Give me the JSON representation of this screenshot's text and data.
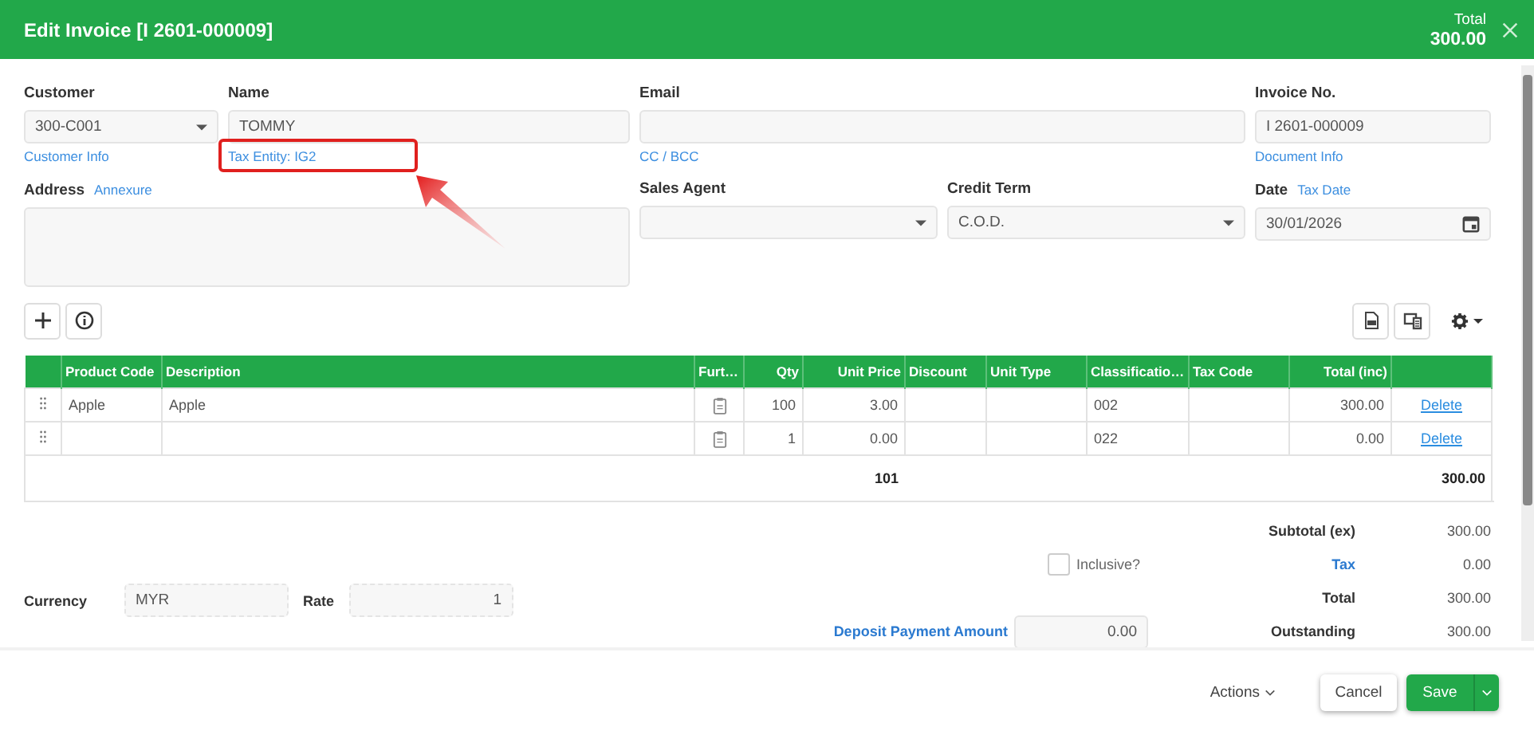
{
  "window": {
    "title": "Edit Invoice [I 2601-000009]",
    "total_label": "Total",
    "total_value": "300.00"
  },
  "customer": {
    "label": "Customer",
    "value": "300-C001",
    "link": "Customer Info"
  },
  "name": {
    "label": "Name",
    "value": "TOMMY",
    "link": "Tax Entity: IG2"
  },
  "email": {
    "label": "Email",
    "link": "CC / BCC"
  },
  "invoice_no": {
    "label": "Invoice No.",
    "value": "I 2601-000009",
    "link": "Document Info"
  },
  "address": {
    "label": "Address",
    "link": "Annexure"
  },
  "sales_agent": {
    "label": "Sales Agent"
  },
  "credit_term": {
    "label": "Credit Term",
    "value": "C.O.D."
  },
  "date": {
    "label": "Date",
    "link": "Tax Date",
    "value": "30/01/2026"
  },
  "table": {
    "columns": [
      "Product Code",
      "Description",
      "Furt…",
      "Qty",
      "Unit Price",
      "Discount",
      "Unit Type",
      "Classificatio…",
      "Tax Code",
      "Total (inc)"
    ],
    "rows": [
      {
        "product_code": "Apple",
        "description": "Apple",
        "qty": "100",
        "unit_price": "3.00",
        "classification": "002",
        "total": "300.00",
        "action": "Delete"
      },
      {
        "qty": "1",
        "unit_price": "0.00",
        "classification": "022",
        "total": "0.00",
        "action": "Delete"
      }
    ],
    "footer": {
      "qty": "101",
      "total": "300.00"
    }
  },
  "currency": {
    "label": "Currency",
    "value": "MYR"
  },
  "rate": {
    "label": "Rate",
    "value": "1"
  },
  "inclusive": {
    "label": "Inclusive?",
    "checked": false
  },
  "deposit": {
    "label": "Deposit Payment Amount",
    "value": "0.00"
  },
  "totals": [
    {
      "label": "Subtotal (ex)",
      "value": "300.00",
      "kind": "plain"
    },
    {
      "label": "Tax",
      "value": "0.00",
      "kind": "link"
    },
    {
      "label": "Total",
      "value": "300.00",
      "kind": "plain"
    },
    {
      "label": "Outstanding",
      "value": "300.00",
      "kind": "plain"
    }
  ],
  "footer": {
    "actions": "Actions",
    "cancel": "Cancel",
    "save": "Save"
  }
}
